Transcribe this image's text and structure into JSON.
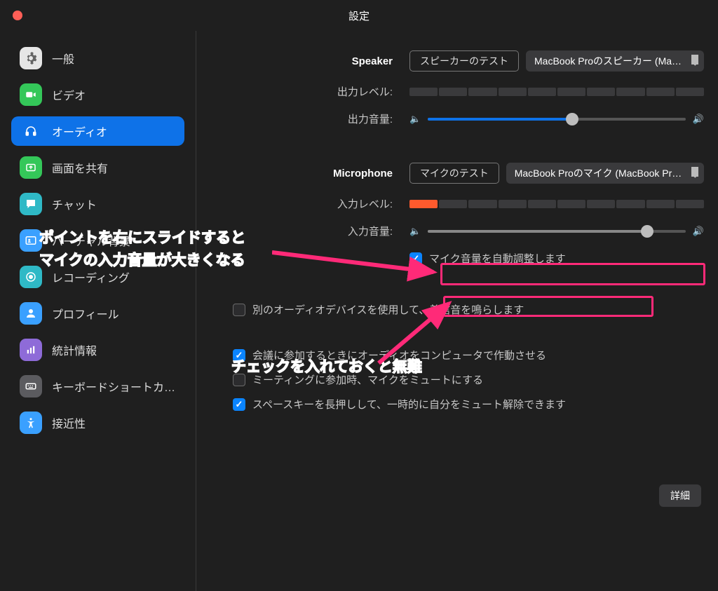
{
  "window": {
    "title": "設定"
  },
  "sidebar": {
    "items": [
      {
        "label": "一般",
        "icon": "gear",
        "bg": "#e6e6e6",
        "fg": "#555"
      },
      {
        "label": "ビデオ",
        "icon": "video",
        "bg": "#34c759",
        "fg": "#fff"
      },
      {
        "label": "オーディオ",
        "icon": "headphones",
        "bg": "#0e72e8",
        "fg": "#fff",
        "active": true
      },
      {
        "label": "画面を共有",
        "icon": "share",
        "bg": "#34c759",
        "fg": "#fff"
      },
      {
        "label": "チャット",
        "icon": "chat",
        "bg": "#2fb9c6",
        "fg": "#fff"
      },
      {
        "label": "バーチャル背景",
        "icon": "contact",
        "bg": "#3aa0ff",
        "fg": "#fff"
      },
      {
        "label": "レコーディング",
        "icon": "record",
        "bg": "#2fb9c6",
        "fg": "#fff"
      },
      {
        "label": "プロフィール",
        "icon": "person",
        "bg": "#3aa0ff",
        "fg": "#fff"
      },
      {
        "label": "統計情報",
        "icon": "stats",
        "bg": "#8e6bd8",
        "fg": "#fff"
      },
      {
        "label": "キーボードショートカ…",
        "icon": "keyboard",
        "bg": "#5b5b5f",
        "fg": "#fff"
      },
      {
        "label": "接近性",
        "icon": "accessibility",
        "bg": "#3aa0ff",
        "fg": "#fff"
      }
    ]
  },
  "speaker": {
    "heading": "Speaker",
    "test_button": "スピーカーのテスト",
    "device": "MacBook Proのスピーカー (MacBook Pro…",
    "output_level_label": "出力レベル:",
    "output_volume_label": "出力音量:",
    "output_volume_pct": 56
  },
  "microphone": {
    "heading": "Microphone",
    "test_button": "マイクのテスト",
    "device": "MacBook Proのマイク (MacBook Proのマ…",
    "input_level_label": "入力レベル:",
    "input_level_segments_on": 1,
    "input_volume_label": "入力音量:",
    "input_volume_pct": 85,
    "auto_adjust_label": "マイク音量を自動調整します",
    "auto_adjust_checked": true
  },
  "options": {
    "separate_ringtone": {
      "label": "別のオーディオデバイスを使用して、着信音を鳴らします",
      "checked": false
    },
    "join_audio": {
      "label": "会議に参加するときにオーディオをコンピュータで作動させる",
      "checked": true
    },
    "mute_on_join": {
      "label": "ミーティングに参加時、マイクをミュートにする",
      "checked": false
    },
    "space_unmute": {
      "label": "スペースキーを長押しして、一時的に自分をミュート解除できます",
      "checked": true
    }
  },
  "advanced_button": "詳細",
  "annotations": {
    "line1": "ポイントを右にスライドすると",
    "line2": "マイクの入力音量が大きくなる",
    "line3": "チェックを入れておくと無難"
  }
}
